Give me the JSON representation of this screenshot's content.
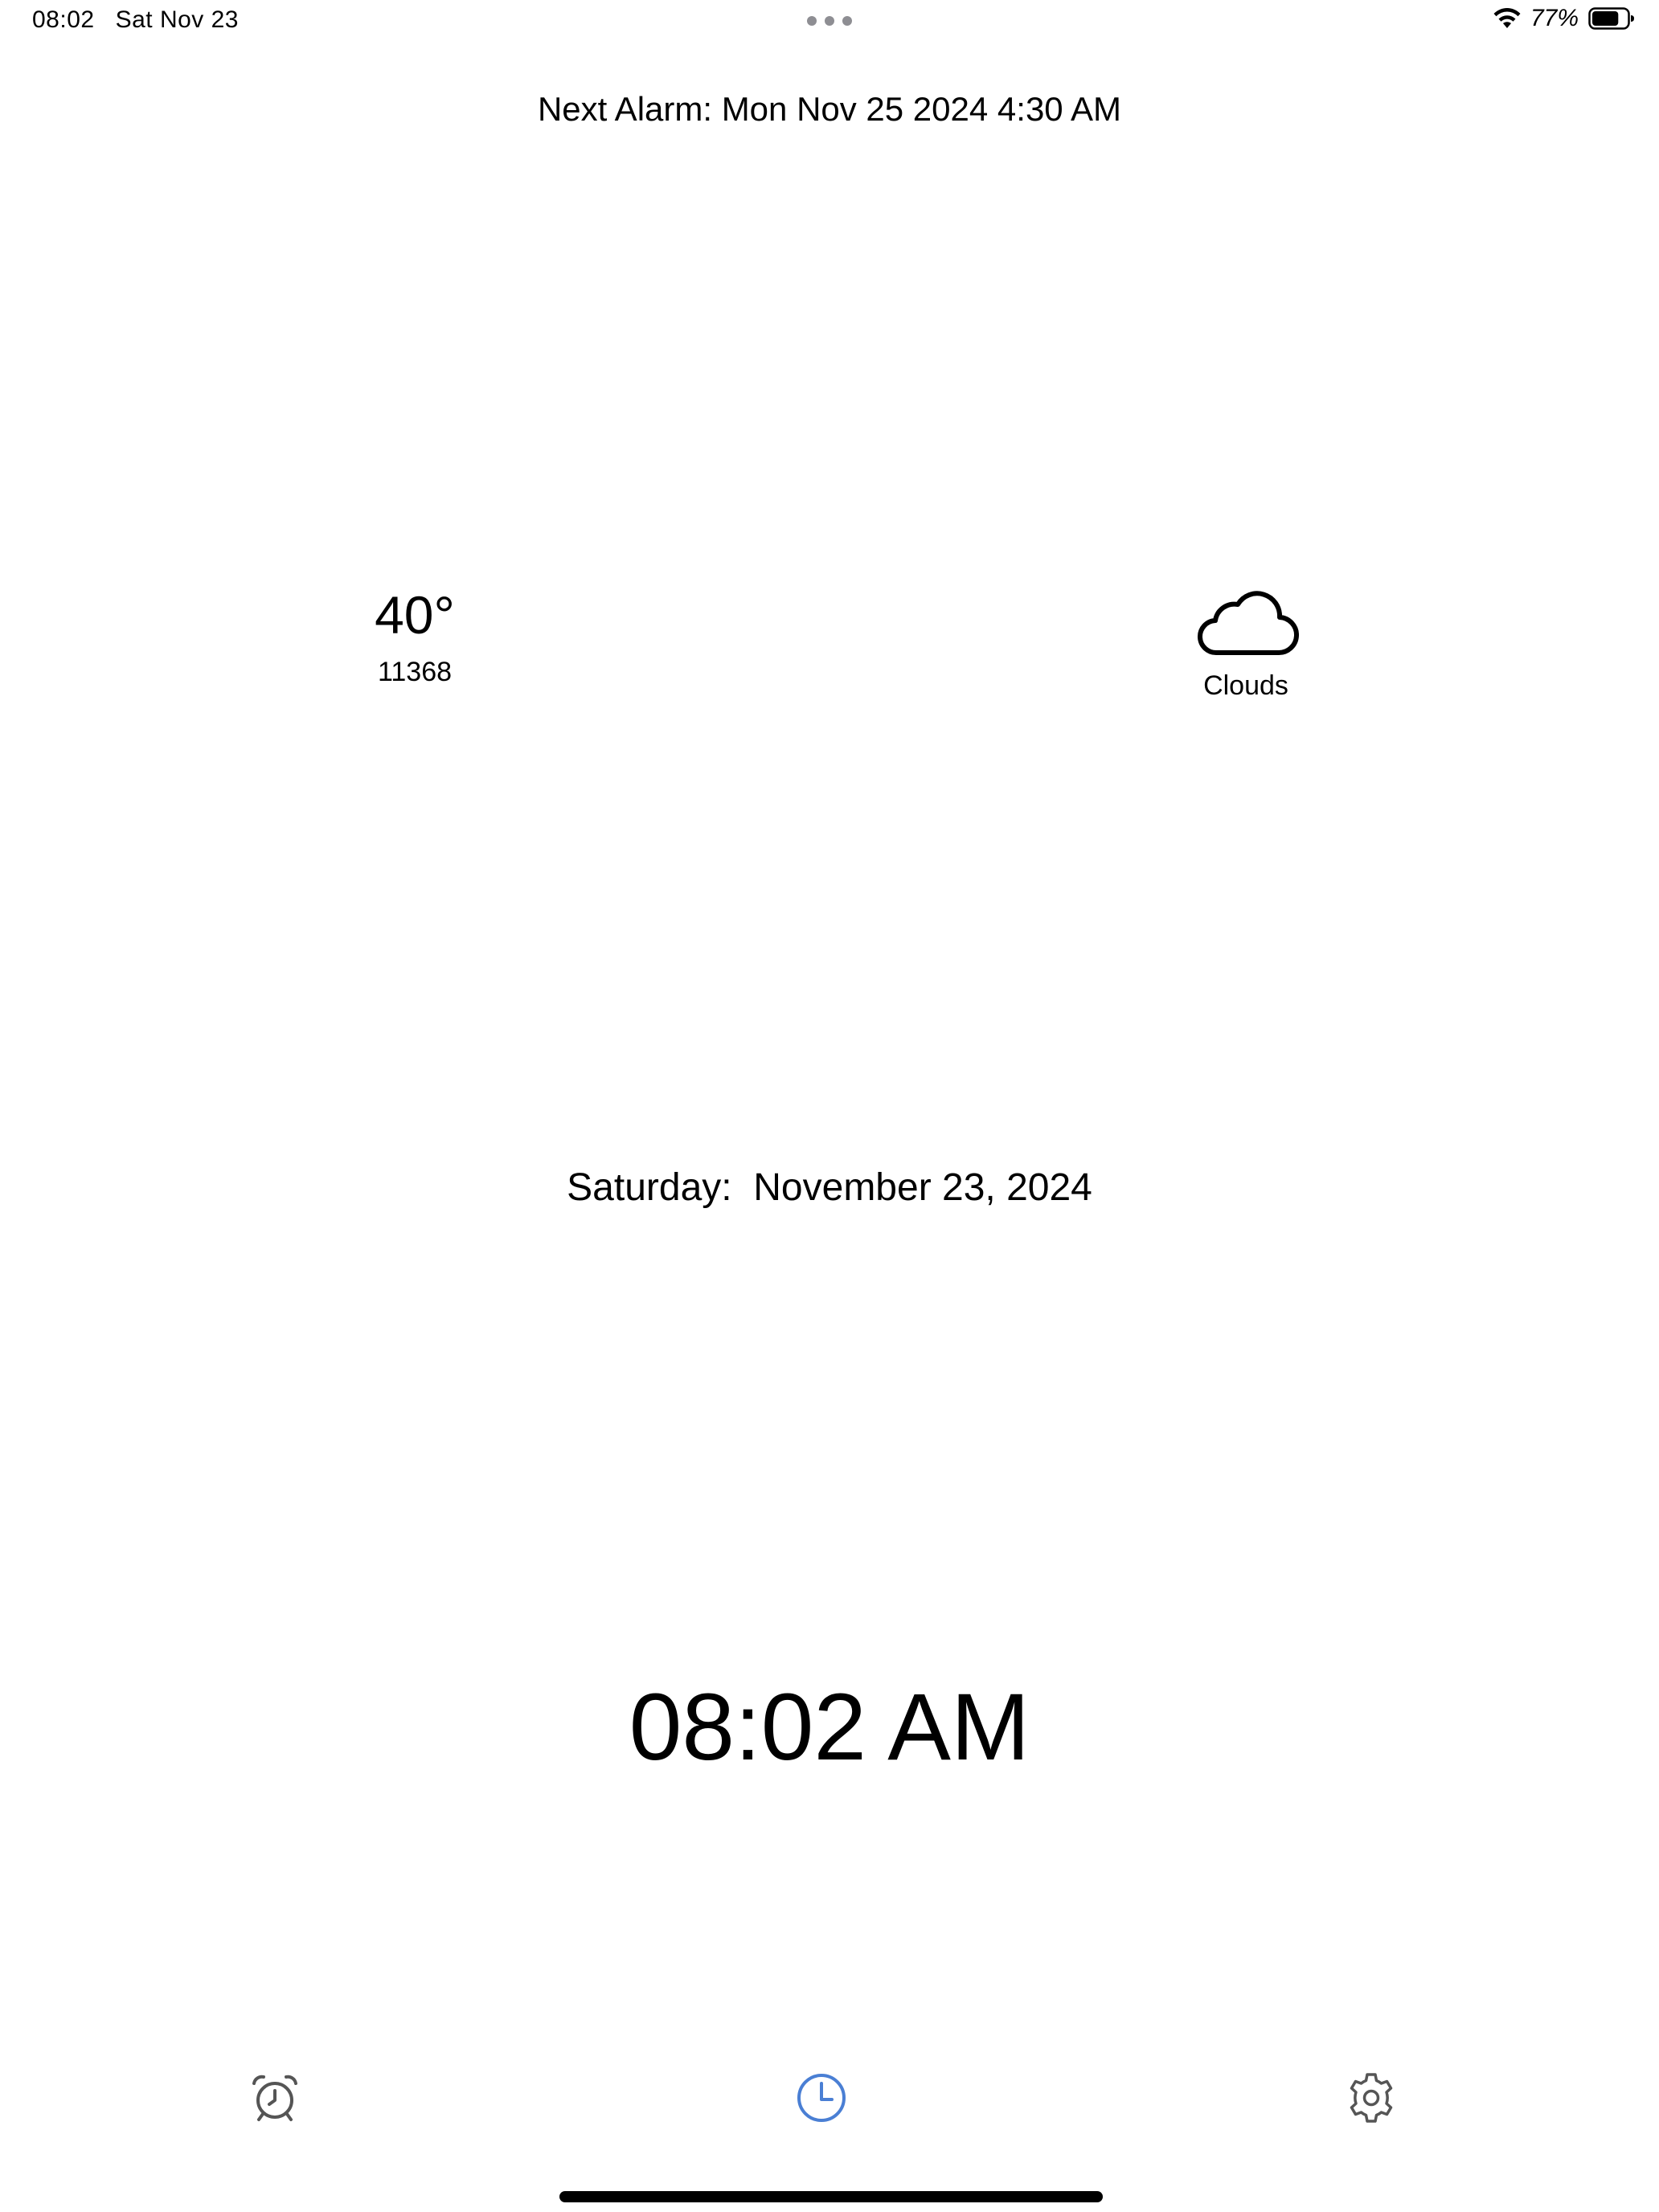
{
  "status_bar": {
    "time": "08:02",
    "date": "Sat Nov 23",
    "battery_percent": "77%",
    "battery_level": 0.77
  },
  "next_alarm": "Next Alarm: Mon Nov 25 2024 4:30 AM",
  "weather": {
    "temperature": "40°",
    "code": "11368",
    "condition": "Clouds",
    "icon": "cloud-icon"
  },
  "date_line": "Saturday:  November 23, 2024",
  "clock": "08:02 AM",
  "tabs": [
    {
      "icon": "alarm-clock-icon",
      "active": false
    },
    {
      "icon": "clock-icon",
      "active": true
    },
    {
      "icon": "gear-icon",
      "active": false
    }
  ],
  "colors": {
    "active_tab": "#4a7fd4",
    "inactive_tab": "#555555"
  }
}
